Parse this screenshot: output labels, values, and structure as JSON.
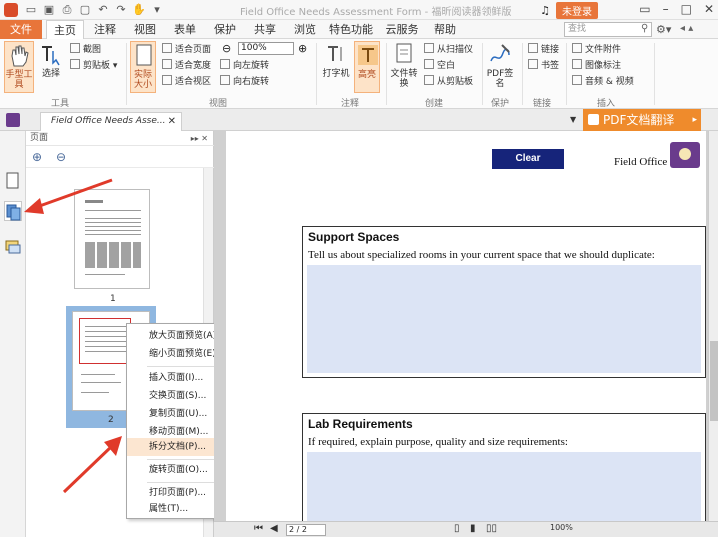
{
  "titlebar": {
    "file_label": "文件",
    "window_title": "Field Office Needs Assessment Form - 福昕阅读器领鲜版",
    "login_label": "未登录"
  },
  "tabs": [
    "主页",
    "注释",
    "视图",
    "表单",
    "保护",
    "共享",
    "浏览",
    "特色功能",
    "云服务",
    "帮助"
  ],
  "search": {
    "placeholder": "查找"
  },
  "ribbon": {
    "hand_tool": "手型工具",
    "select": "选择",
    "screenshot": "截图",
    "clipboard": "剪贴板",
    "group_tools": "工具",
    "actual_size": "实际大小",
    "fit_page": "适合页面",
    "fit_width": "适合宽度",
    "fit_visible": "适合视区",
    "zoom_value": "100%",
    "rotate_left": "向左旋转",
    "rotate_right": "向右旋转",
    "group_view": "视图",
    "typewriter": "打字机",
    "highlight": "高亮",
    "group_comment": "注释",
    "convert": "文件转换",
    "from_scanner": "从扫描仪",
    "blank": "空白",
    "from_clipboard": "从剪贴板",
    "group_create": "创建",
    "pdf_sign": "PDF签名",
    "group_protect": "保护",
    "link": "链接",
    "bookmark": "书签",
    "group_links": "链接",
    "file_attach": "文件附件",
    "image_annot": "图像标注",
    "audio_video": "音频 & 视频",
    "group_insert": "插入"
  },
  "doc_tab": {
    "label": "Field Office Needs Asse..."
  },
  "translate": {
    "label": "PDF文档翻译"
  },
  "panel": {
    "title": "页面",
    "page1": "1",
    "page2": "2"
  },
  "context_menu": [
    {
      "label": "放大页面预览(A)",
      "sub": false,
      "hl": false
    },
    {
      "label": "缩小页面预览(E)",
      "sub": false,
      "hl": false
    },
    {
      "label": "插入页面(I)...",
      "sub": true,
      "hl": false
    },
    {
      "label": "交换页面(S)...",
      "sub": false,
      "hl": false
    },
    {
      "label": "复制页面(U)...",
      "sub": false,
      "hl": false
    },
    {
      "label": "移动页面(M)...",
      "sub": false,
      "hl": false
    },
    {
      "label": "拆分文档(P)...",
      "sub": false,
      "hl": true
    },
    {
      "label": "旋转页面(O)...",
      "sub": false,
      "hl": false
    },
    {
      "label": "打印页面(P)...",
      "sub": false,
      "hl": false
    },
    {
      "label": "属性(T)...",
      "sub": false,
      "hl": false
    }
  ],
  "document": {
    "clear_label": "Clear",
    "header_text": "Field Office Needs",
    "sections": [
      {
        "title": "Support Spaces",
        "desc": "Tell us about specialized rooms in your current space that we should duplicate:"
      },
      {
        "title": "Lab Requirements",
        "desc": "If required, explain purpose, quality and size requirements:"
      }
    ]
  },
  "statusbar": {
    "page_value": "2 / 2",
    "zoom": "100%"
  },
  "colors": {
    "accent": "#e8753a",
    "annotation_arrow": "#e03a2a",
    "clear_button": "#16247a",
    "field_fill": "#dce4f5"
  }
}
